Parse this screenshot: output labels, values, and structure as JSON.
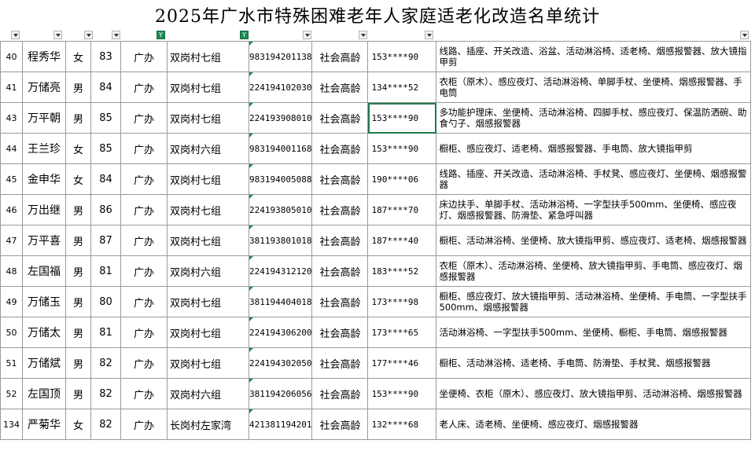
{
  "title": "2025年广水市特殊困难老年人家庭适老化改造名单统计",
  "filter_icon": "funnel-icon",
  "colors": {
    "grid": "#9a9a9a",
    "filter_active": "#1e8a55",
    "selection": "#1e7b4c"
  },
  "rows": [
    {
      "no": "40",
      "name": "程秀华",
      "gender": "女",
      "age": "83",
      "office": "广办",
      "village": "双岗村七组",
      "id": "983194201138",
      "category": "社会高龄",
      "phone": "153****90",
      "items": "线路、插座、开关改造、浴盆、活动淋浴椅、适老椅、烟感报警器、放大镜指甲剪"
    },
    {
      "no": "41",
      "name": "万储亮",
      "gender": "男",
      "age": "84",
      "office": "广办",
      "village": "双岗村七组",
      "id": "224194102030",
      "category": "社会高龄",
      "phone": "134****52",
      "items": "衣柜（原木）、感应夜灯、活动淋浴椅、单脚手杖、坐便椅、烟感报警器、手电筒"
    },
    {
      "no": "43",
      "name": "万平朝",
      "gender": "男",
      "age": "85",
      "office": "广办",
      "village": "双岗村七组",
      "id": "224193908010",
      "category": "社会高龄",
      "phone": "153****90",
      "items": "多功能护理床、坐便椅、活动淋浴椅、四脚手杖、感应夜灯、保温防洒碗、助食勺子、烟感报警器"
    },
    {
      "no": "44",
      "name": "王兰珍",
      "gender": "女",
      "age": "85",
      "office": "广办",
      "village": "双岗村六组",
      "id": "983194001168",
      "category": "社会高龄",
      "phone": "153****90",
      "items": "橱柜、感应夜灯、适老椅、烟感报警器、手电筒、放大镜指甲剪"
    },
    {
      "no": "45",
      "name": "金申华",
      "gender": "女",
      "age": "84",
      "office": "广办",
      "village": "双岗村七组",
      "id": "983194005088",
      "category": "社会高龄",
      "phone": "190****06",
      "items": "线路、插座、开关改造、活动淋浴椅、手杖凳、感应夜灯、坐便椅、烟感报警器"
    },
    {
      "no": "46",
      "name": "万出继",
      "gender": "男",
      "age": "86",
      "office": "广办",
      "village": "双岗村七组",
      "id": "224193805010",
      "category": "社会高龄",
      "phone": "187****70",
      "items": "床边扶手、单脚手杖、活动淋浴椅、一字型扶手500mm、坐便椅、感应夜灯、烟感报警器、防滑垫、紧急呼叫器"
    },
    {
      "no": "47",
      "name": "万平喜",
      "gender": "男",
      "age": "87",
      "office": "广办",
      "village": "双岗村七组",
      "id": "381193801018",
      "category": "社会高龄",
      "phone": "187****40",
      "items": "橱柜、活动淋浴椅、坐便椅、放大镜指甲剪、感应夜灯、适老椅、烟感报警器"
    },
    {
      "no": "48",
      "name": "左国福",
      "gender": "男",
      "age": "81",
      "office": "广办",
      "village": "双岗村六组",
      "id": "224194312120",
      "category": "社会高龄",
      "phone": "183****52",
      "items": "衣柜（原木）、活动淋浴椅、坐便椅、放大镜指甲剪、手电筒、感应夜灯、烟感报警器"
    },
    {
      "no": "49",
      "name": "万储玉",
      "gender": "男",
      "age": "80",
      "office": "广办",
      "village": "双岗村七组",
      "id": "381194404018",
      "category": "社会高龄",
      "phone": "173****98",
      "items": "橱柜、感应夜灯、放大镜指甲剪、活动淋浴椅、坐便椅、手电筒、一字型扶手500mm、烟感报警器"
    },
    {
      "no": "50",
      "name": "万储太",
      "gender": "男",
      "age": "81",
      "office": "广办",
      "village": "双岗村七组",
      "id": "224194306200",
      "category": "社会高龄",
      "phone": "173****65",
      "items": "活动淋浴椅、一字型扶手500mm、坐便椅、橱柜、手电筒、烟感报警器"
    },
    {
      "no": "51",
      "name": "万储斌",
      "gender": "男",
      "age": "82",
      "office": "广办",
      "village": "双岗村七组",
      "id": "224194302050",
      "category": "社会高龄",
      "phone": "177****46",
      "items": "橱柜、活动淋浴椅、适老椅、手电筒、防滑垫、手杖凳、烟感报警器"
    },
    {
      "no": "52",
      "name": "左国顶",
      "gender": "男",
      "age": "82",
      "office": "广办",
      "village": "双岗村六组",
      "id": "381194206056",
      "category": "社会高龄",
      "phone": "153****90",
      "items": "坐便椅、衣柜（原木）、感应夜灯、放大镜指甲剪、活动淋浴椅、烟感报警器"
    },
    {
      "no": "134",
      "name": "严菊华",
      "gender": "女",
      "age": "82",
      "office": "广办",
      "village": "长岗村左家湾",
      "id": "421381194201",
      "category": "社会高龄",
      "phone": "132****68",
      "items": "老人床、适老椅、坐便椅、感应夜灯、烟感报警器"
    }
  ]
}
